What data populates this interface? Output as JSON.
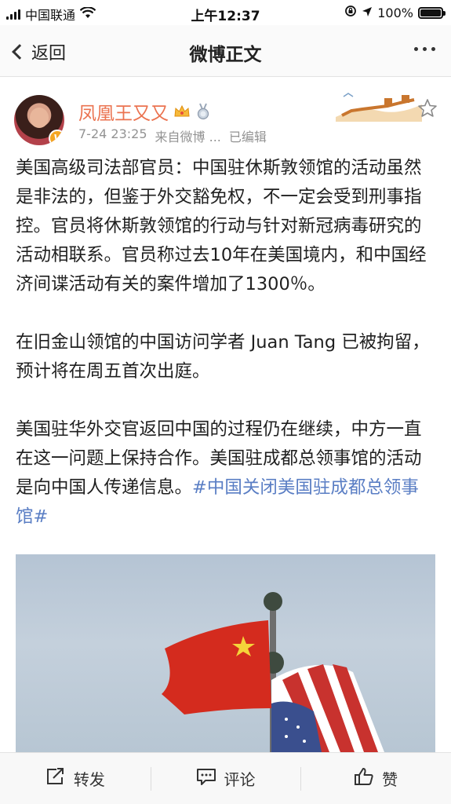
{
  "status_bar": {
    "carrier": "中国联通",
    "time": "上午12:37",
    "battery": "100%",
    "battery_level": 1.0
  },
  "nav": {
    "back_label": "返回",
    "title": "微博正文"
  },
  "post": {
    "username": "凤凰王又又",
    "timestamp": "7-24 23:25",
    "source": "来自微博 ...",
    "edited": "已编辑",
    "paragraphs": {
      "p1": "美国高级司法部官员：中国驻休斯敦领馆的活动虽然是非法的，但鉴于外交豁免权，不一定会受到刑事指控。官员将休斯敦领馆的行动与针对新冠病毒研究的活动相联系。官员称过去10年在美国境内，和中国经济间谍活动有关的案件增加了1300％。",
      "p2": "在旧金山领馆的中国访问学者 Juan Tang 已被拘留，预计将在周五首次出庭。",
      "p3_text": "美国驻华外交官返回中国的过程仍在继续，中方一直在这一问题上保持合作。美国驻成都总领事馆的活动是向中国人传递信息。",
      "p3_hashtag": "#中国关闭美国驻成都总领事馆#"
    }
  },
  "toolbar": {
    "repost_label": "转发",
    "comment_label": "评论",
    "like_label": "赞"
  },
  "colors": {
    "username": "#eb7350",
    "hashtag": "#5a7ec4",
    "meta": "#939393"
  },
  "icons": [
    "signal-icon",
    "wifi-icon",
    "lock-rotation-icon",
    "location-icon",
    "battery-icon",
    "back-chevron-icon",
    "more-icon",
    "crown-icon",
    "medal-icon",
    "verified-badge-icon",
    "star-icon",
    "repost-icon",
    "comment-icon",
    "like-icon"
  ]
}
